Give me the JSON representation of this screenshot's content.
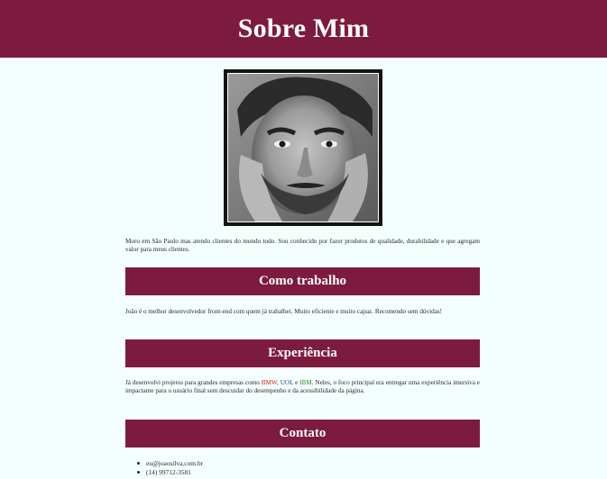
{
  "header": {
    "title": "Sobre Mim"
  },
  "photo": {
    "alt": "Foto de João Silva"
  },
  "intro": {
    "text": "Moro em São Paulo mas atendo clientes do mundo todo. Sou conhecido por fazer produtos de qualidade, durabilidade e que agregam valor para meus clientes."
  },
  "sections": {
    "work": {
      "title": "Como trabalho",
      "text": "João é o melhor desenvolvedor front-end com quem já trabalhei. Muito eficiente e muito capaz. Recomendo sem dúvidas!"
    },
    "experience": {
      "title": "Experiência",
      "text_before": "Já desenvolvi projetos para grandes empresas como ",
      "brand_bmw": "BMW",
      "sep1": ", ",
      "brand_uol": "UOL",
      "sep2": " e ",
      "brand_ibm": "IBM",
      "text_after": ". Neles, o foco principal era entregar uma experiência imersiva e impactante para o usuário final sem descuidar do desempenho e da acessibilidade da página."
    },
    "contact": {
      "title": "Contato",
      "items": [
        "eu@joaosilva.com.br",
        "(14) 99712-3581"
      ]
    }
  },
  "colors": {
    "accent": "#7d1b3f",
    "background": "#f4fffd",
    "bmw": "#d0201c",
    "uol": "#2c3f9e",
    "ibm": "#2a8a2a"
  }
}
